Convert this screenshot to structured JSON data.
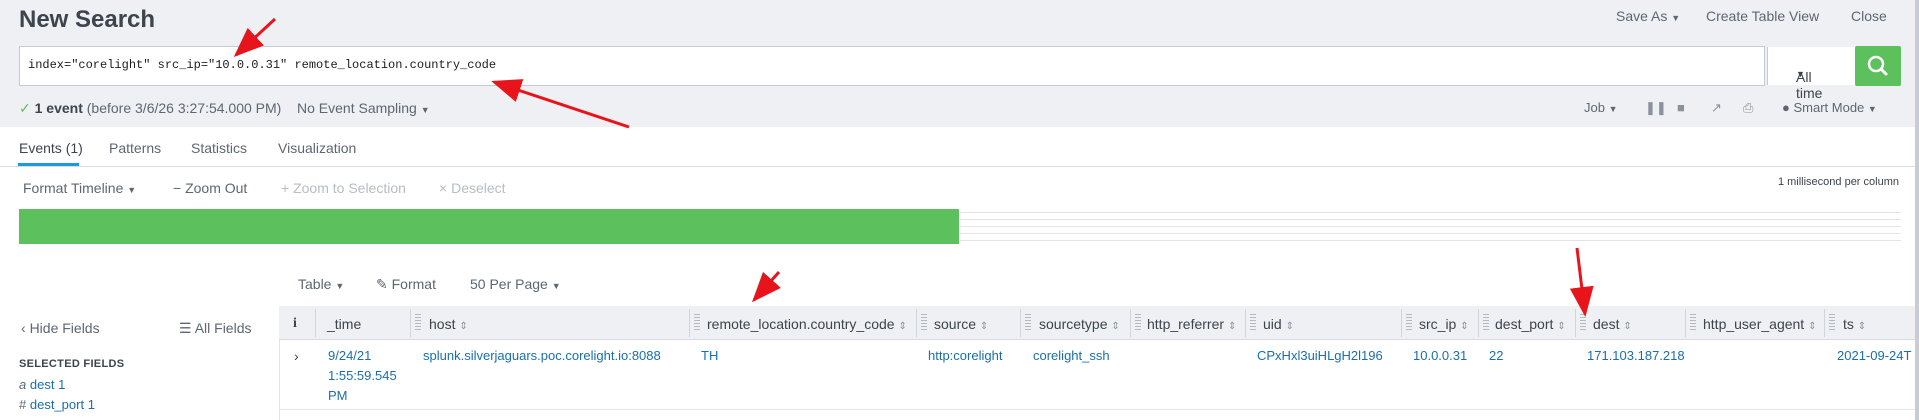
{
  "header": {
    "title": "New Search",
    "save_as": "Save As",
    "create_table_view": "Create Table View",
    "close": "Close"
  },
  "search": {
    "query": "index=\"corelight\" src_ip=\"10.0.0.31\" remote_location.country_code",
    "time_range": "All time"
  },
  "status": {
    "event_count": "1 event",
    "event_detail": "(before 3/6/26 3:27:54.000 PM)",
    "sampling": "No Event Sampling",
    "job": "Job",
    "mode": "Smart Mode"
  },
  "tabs": [
    {
      "label": "Events (1)",
      "active": true
    },
    {
      "label": "Patterns"
    },
    {
      "label": "Statistics"
    },
    {
      "label": "Visualization"
    }
  ],
  "timeline": {
    "format": "Format Timeline",
    "zoom_out": "Zoom Out",
    "zoom_selection": "Zoom to Selection",
    "deselect": "Deselect",
    "scale_label": "1 millisecond per column"
  },
  "table_toolbar": {
    "view": "Table",
    "format": "Format",
    "per_page": "50 Per Page"
  },
  "sidebar": {
    "hide_fields": "Hide Fields",
    "all_fields": "All Fields",
    "selected_header": "SELECTED FIELDS",
    "fields": [
      {
        "type": "a",
        "name": "dest",
        "count": "1"
      },
      {
        "type": "#",
        "name": "dest_port",
        "count": "1"
      }
    ]
  },
  "columns": [
    "i",
    "_time",
    "host",
    "remote_location.country_code",
    "source",
    "sourcetype",
    "http_referrer",
    "uid",
    "src_ip",
    "dest_port",
    "dest",
    "http_user_agent",
    "ts"
  ],
  "rows": [
    {
      "time": "9/24/21 1:55:59.545 PM",
      "host": "splunk.silverjaguars.poc.corelight.io:8088",
      "country_code": "TH",
      "source": "http:corelight",
      "sourcetype": "corelight_ssh",
      "http_referrer": "",
      "uid": "CPxHxl3uiHLgH2l196",
      "src_ip": "10.0.0.31",
      "dest_port": "22",
      "dest": "171.103.187.218",
      "http_user_agent": "",
      "ts": "2021-09-24T"
    }
  ],
  "colors": {
    "accent": "#1a9ad6",
    "go_button": "#5cc05c",
    "timeline_bar": "#5cc05c",
    "link": "#1a6eaa",
    "annotation_arrow": "#e8141b"
  }
}
